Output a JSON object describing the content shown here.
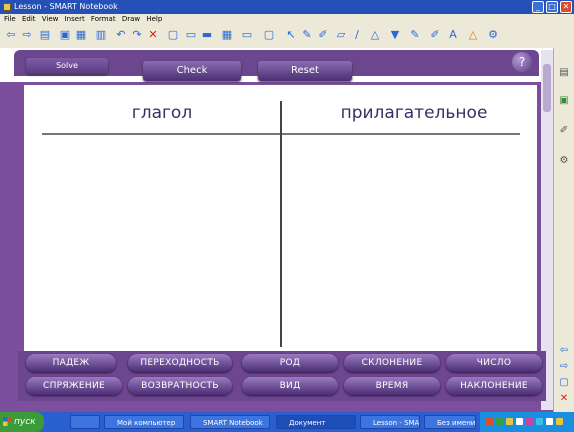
{
  "window": {
    "title": "Lesson - SMART Notebook",
    "controls": [
      "_",
      "□",
      "✕"
    ]
  },
  "menu": {
    "items": [
      "File",
      "Edit",
      "View",
      "Insert",
      "Format",
      "Draw",
      "Help"
    ]
  },
  "toolbar": {
    "icons": [
      "back-arrow-icon",
      "forward-arrow-icon",
      "page-icon",
      "open-icon",
      "save-icon",
      "paste-icon",
      "undo-icon",
      "redo-icon",
      "delete-icon",
      "screen-shade-icon",
      "full-screen-icon",
      "capture-icon",
      "table-icon",
      "select-icon",
      "pen-icon",
      "creative-pen-icon",
      "eraser-icon",
      "line-icon",
      "shapes-icon",
      "fill-icon",
      "text-icon",
      "properties-icon"
    ],
    "glyphs": [
      "⇦",
      "⇨",
      "▤",
      "▣",
      "▦",
      "▥",
      "↶",
      "↷",
      "✕",
      "▢",
      "▭",
      "▬",
      "▦",
      "↖",
      "✎",
      "✐",
      "▱",
      "∕",
      "△",
      "▼",
      "A",
      "⚙"
    ]
  },
  "activity": {
    "buttons": {
      "solve": "Solve",
      "check": "Check",
      "reset": "Reset",
      "help": "?"
    },
    "columns": [
      "глагол",
      "прилагательное"
    ],
    "chips_row1": [
      "ПАДЕЖ",
      "ПЕРЕХОДНОСТЬ",
      "РОД",
      "СКЛОНЕНИЕ",
      "ЧИСЛО"
    ],
    "chips_row2": [
      "СПРЯЖЕНИЕ",
      "ВОЗВРАТНОСТЬ",
      "ВИД",
      "ВРЕМЯ",
      "НАКЛОНЕНИЕ"
    ]
  },
  "sidebar": {
    "tabs": [
      "page-sorter-tab",
      "gallery-tab",
      "attachments-tab",
      "properties-tab"
    ],
    "arrows": [
      "⇦",
      "⇨",
      "▢",
      "✕"
    ]
  },
  "taskbar": {
    "start_label": "пуск",
    "tasks": [
      "Мой компьютер",
      "SMART Notebook",
      "Документ",
      "Lesson - SMART",
      "Без имени"
    ]
  },
  "colors": {
    "accent_purple": "#6d4690",
    "button_gradient_top": "#8a6bb0",
    "title_blue": "#2450b8",
    "heading_text": "#3a2f63"
  }
}
